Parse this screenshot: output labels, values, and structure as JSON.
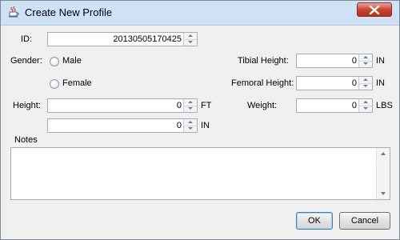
{
  "window": {
    "title": "Create New Profile"
  },
  "form": {
    "id_label": "ID:",
    "id_value": "20130505170425",
    "gender_label": "Gender:",
    "gender_male": "Male",
    "gender_female": "Female",
    "height_label": "Height:",
    "height_ft_value": "0",
    "height_ft_unit": "FT",
    "height_in_value": "0",
    "height_in_unit": "IN",
    "tibial_label": "Tibial Height:",
    "tibial_value": "0",
    "tibial_unit": "IN",
    "femoral_label": "Femoral Height:",
    "femoral_value": "0",
    "femoral_unit": "IN",
    "weight_label": "Weight:",
    "weight_value": "0",
    "weight_unit": "LBS",
    "notes_label": "Notes",
    "notes_value": ""
  },
  "buttons": {
    "ok": "OK",
    "cancel": "Cancel"
  }
}
